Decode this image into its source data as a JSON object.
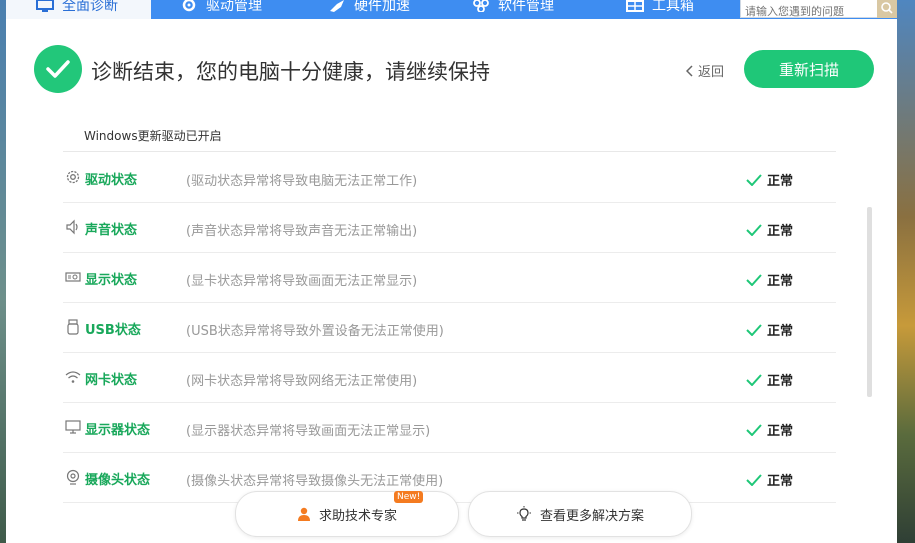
{
  "topnav": {
    "tabs": [
      {
        "label": "全面诊断",
        "icon": "monitor-icon"
      },
      {
        "label": "驱动管理",
        "icon": "gear-icon"
      },
      {
        "label": "硬件加速",
        "icon": "rocket-icon"
      },
      {
        "label": "软件管理",
        "icon": "apps-icon"
      },
      {
        "label": "工具箱",
        "icon": "toolbox-icon"
      }
    ],
    "search_placeholder": "请输入您遇到的问题"
  },
  "header": {
    "headline": "诊断结束，您的电脑十分健康，请继续保持",
    "back_label": "返回",
    "rescan_label": "重新扫描"
  },
  "notice": "Windows更新驱动已开启",
  "rows": [
    {
      "name": "驱动状态",
      "desc": "(驱动状态异常将导致电脑无法正常工作)",
      "status": "正常",
      "icon": "gear-icon"
    },
    {
      "name": "声音状态",
      "desc": "(声音状态异常将导致声音无法正常输出)",
      "status": "正常",
      "icon": "speaker-icon"
    },
    {
      "name": "显示状态",
      "desc": "(显卡状态异常将导致画面无法正常显示)",
      "status": "正常",
      "icon": "graphics-card-icon"
    },
    {
      "name": "USB状态",
      "desc": "(USB状态异常将导致外置设备无法正常使用)",
      "status": "正常",
      "icon": "usb-icon"
    },
    {
      "name": "网卡状态",
      "desc": "(网卡状态异常将导致网络无法正常使用)",
      "status": "正常",
      "icon": "wifi-icon"
    },
    {
      "name": "显示器状态",
      "desc": "(显示器状态异常将导致画面无法正常显示)",
      "status": "正常",
      "icon": "monitor-icon"
    },
    {
      "name": "摄像头状态",
      "desc": "(摄像头状态异常将导致摄像头无法正常使用)",
      "status": "正常",
      "icon": "camera-icon"
    }
  ],
  "bottom": {
    "support_label": "求助技术专家",
    "new_badge": "New!",
    "more_label": "查看更多解决方案"
  },
  "colors": {
    "accent_blue": "#3e8df1",
    "success_green": "#1fc778",
    "row_name_green": "#19a85b"
  }
}
